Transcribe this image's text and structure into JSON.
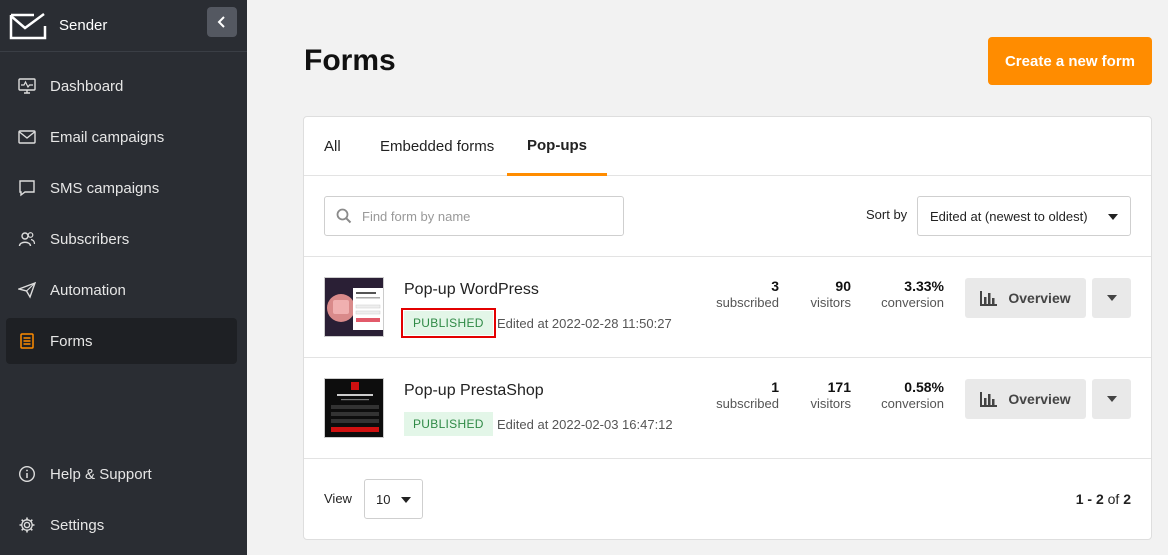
{
  "brand": {
    "name": "Sender"
  },
  "sidebar": {
    "items": [
      {
        "label": "Dashboard",
        "icon": "monitor-icon"
      },
      {
        "label": "Email campaigns",
        "icon": "envelope-icon"
      },
      {
        "label": "SMS campaigns",
        "icon": "chat-icon"
      },
      {
        "label": "Subscribers",
        "icon": "users-icon"
      },
      {
        "label": "Automation",
        "icon": "paper-plane-icon"
      },
      {
        "label": "Forms",
        "icon": "form-icon",
        "active": true
      }
    ],
    "bottom_items": [
      {
        "label": "Help & Support",
        "icon": "info-icon"
      },
      {
        "label": "Settings",
        "icon": "gear-icon"
      }
    ]
  },
  "header": {
    "title": "Forms",
    "create_button": "Create a new form"
  },
  "tabs": [
    {
      "label": "All"
    },
    {
      "label": "Embedded forms"
    },
    {
      "label": "Pop-ups",
      "active": true
    }
  ],
  "search": {
    "placeholder": "Find form by name",
    "value": ""
  },
  "sort": {
    "label": "Sort by",
    "selected": "Edited at (newest to oldest)"
  },
  "forms": [
    {
      "name": "Pop-up WordPress",
      "status": "PUBLISHED",
      "edited": "Edited at 2022-02-28 11:50:27",
      "subscribed": "3",
      "subscribed_label": "subscribed",
      "visitors": "90",
      "visitors_label": "visitors",
      "conversion": "3.33%",
      "conversion_label": "conversion",
      "overview_label": "Overview"
    },
    {
      "name": "Pop-up PrestaShop",
      "status": "PUBLISHED",
      "edited": "Edited at 2022-02-03 16:47:12",
      "subscribed": "1",
      "subscribed_label": "subscribed",
      "visitors": "171",
      "visitors_label": "visitors",
      "conversion": "0.58%",
      "conversion_label": "conversion",
      "overview_label": "Overview"
    }
  ],
  "footer": {
    "view_label": "View",
    "per_page": "10",
    "range": "1 - 2",
    "of_label": "of",
    "total": "2"
  },
  "colors": {
    "accent": "#ff8c00",
    "sidebar": "#2a2d33",
    "badge_bg": "#e3f6e8",
    "badge_text": "#2f8a46",
    "highlight": "#e30000"
  }
}
